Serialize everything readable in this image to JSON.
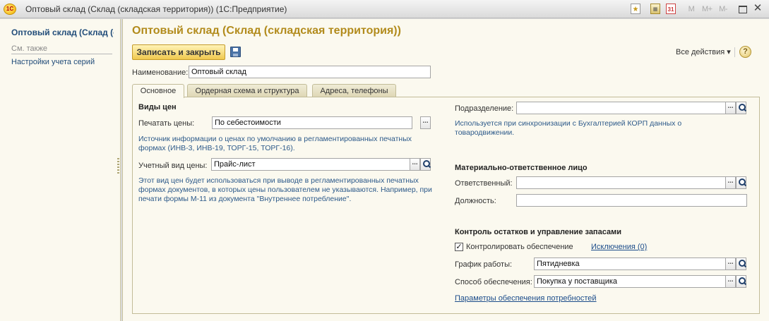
{
  "window": {
    "title": "Оптовый склад (Склад (складская территория))  (1С:Предприятие)",
    "logo_text": "1С",
    "m_buttons": [
      "M",
      "M+",
      "M-"
    ]
  },
  "left_panel": {
    "title": "Оптовый склад (Склад (складская территория))",
    "see_also": "См. также",
    "link": "Настройки учета серий"
  },
  "form": {
    "title": "Оптовый склад (Склад (складская территория))",
    "save_close_label": "Записать и закрыть",
    "all_actions_label": "Все действия",
    "help_label": "?",
    "name_label": "Наименование:",
    "name_value": "Оптовый склад",
    "tabs": [
      {
        "label": "Основное",
        "active": true
      },
      {
        "label": "Ордерная схема и структура",
        "active": false
      },
      {
        "label": "Адреса, телефоны",
        "active": false
      }
    ]
  },
  "left_col": {
    "price_types_header": "Виды цен",
    "print_prices_label": "Печатать цены:",
    "print_prices_value": "По себестоимости",
    "print_prices_hint": "Источник информации о ценах по умолчанию в регламентированных печатных формах (ИНВ-3, ИНВ-19, ТОРГ-15, ТОРГ-16).",
    "account_price_label": "Учетный вид цены:",
    "account_price_value": "Прайс-лист",
    "account_price_hint": "Этот вид цен будет использоваться при выводе в регламентированных печатных формах документов, в которых цены пользователем не указываются. Например, при печати формы М-11 из документа \"Внутреннее потребление\"."
  },
  "right_col": {
    "division_label": "Подразделение:",
    "division_value": "",
    "division_hint": "Используется при синхронизации с Бухгалтерией КОРП данных о товародвижении.",
    "responsible_header": "Материально-ответственное лицо",
    "responsible_label": "Ответственный:",
    "responsible_value": "",
    "position_label": "Должность:",
    "position_value": "",
    "stock_header": "Контроль остатков и управление запасами",
    "control_supply_label": "Контролировать обеспечение",
    "control_supply_checked": true,
    "check_mark": "✓",
    "exceptions_link": "Исключения (0)",
    "schedule_label": "График работы:",
    "schedule_value": "Пятидневка",
    "supply_method_label": "Способ обеспечения:",
    "supply_method_value": "Покупка у поставщика",
    "supply_params_link": "Параметры обеспечения потребностей"
  },
  "icons": {
    "select_dots": "...",
    "dropdown_arrow": "▾"
  },
  "colors": {
    "title_gold": "#b28b1c",
    "link_blue": "#1b4c8a",
    "hint_blue": "#2d5a8a",
    "panel_bg": "#fbf9ef",
    "button_yellow": "#f0c94e"
  }
}
